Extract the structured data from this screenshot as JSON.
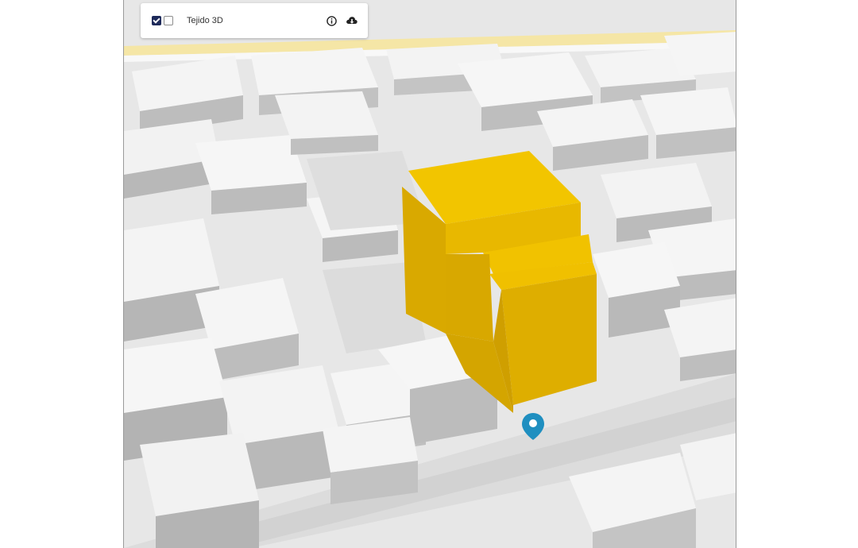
{
  "layer_panel": {
    "layer_name": "Tejido 3D",
    "checkbox_primary_checked": true,
    "checkbox_secondary_checked": false,
    "info_icon": "info-icon",
    "download_icon": "cloud-download-icon"
  },
  "map": {
    "highlight_color": "#f0c400",
    "building_color": "#f2f2f2",
    "ground_color": "#e6e6e6",
    "road_color": "#f6e7a8",
    "marker_icon": "location-pin-icon",
    "marker_color": "#1f8fc0"
  }
}
